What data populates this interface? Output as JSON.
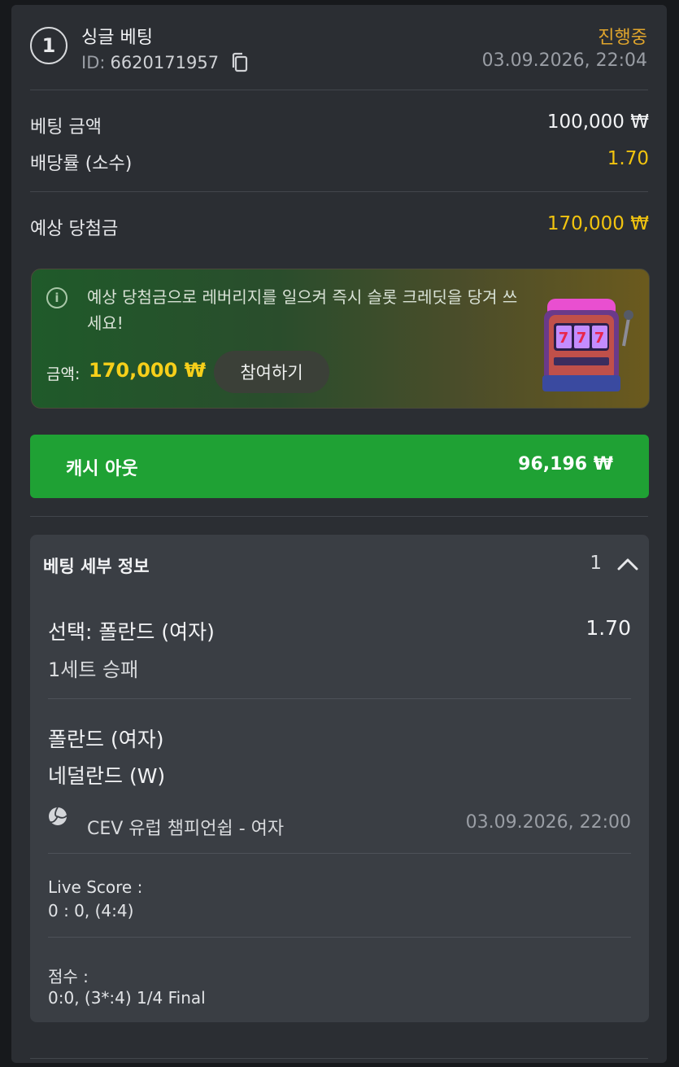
{
  "header": {
    "index": "1",
    "title": "싱글 베팅",
    "id_label": "ID:",
    "id_value": "6620171957",
    "status": "진행중",
    "datetime": "03.09.2026, 22:04"
  },
  "summary": {
    "stake_label": "베팅 금액",
    "stake_value": "100,000 ₩",
    "odds_label": "배당률 (소수)",
    "odds_value": "1.70",
    "payout_label": "예상 당첨금",
    "payout_value": "170,000 ₩"
  },
  "promo": {
    "text": "예상 당첨금으로 레버리지를 일으켜 즉시 슬롯 크레딧을 당겨 쓰세요!",
    "amount_label": "금액:",
    "amount_value": "170,000 ₩",
    "join_label": "참여하기"
  },
  "cashout": {
    "label": "캐시 아웃",
    "value": "96,196 ₩"
  },
  "details": {
    "title": "베팅 세부 정보",
    "count": "1",
    "selection": "선택: 폴란드 (여자)",
    "selection_odds": "1.70",
    "market": "1세트 승패",
    "team_home": "폴란드 (여자)",
    "team_away": "네덜란드 (W)",
    "league": "CEV 유럽 챔피언쉽 - 여자",
    "event_time": "03.09.2026, 22:00",
    "live_score_label": "Live Score :",
    "live_score_value": "0 : 0, (4:4)",
    "score_label": "점수 :",
    "score_value": "0:0, (3*:4) 1/4 Final"
  }
}
